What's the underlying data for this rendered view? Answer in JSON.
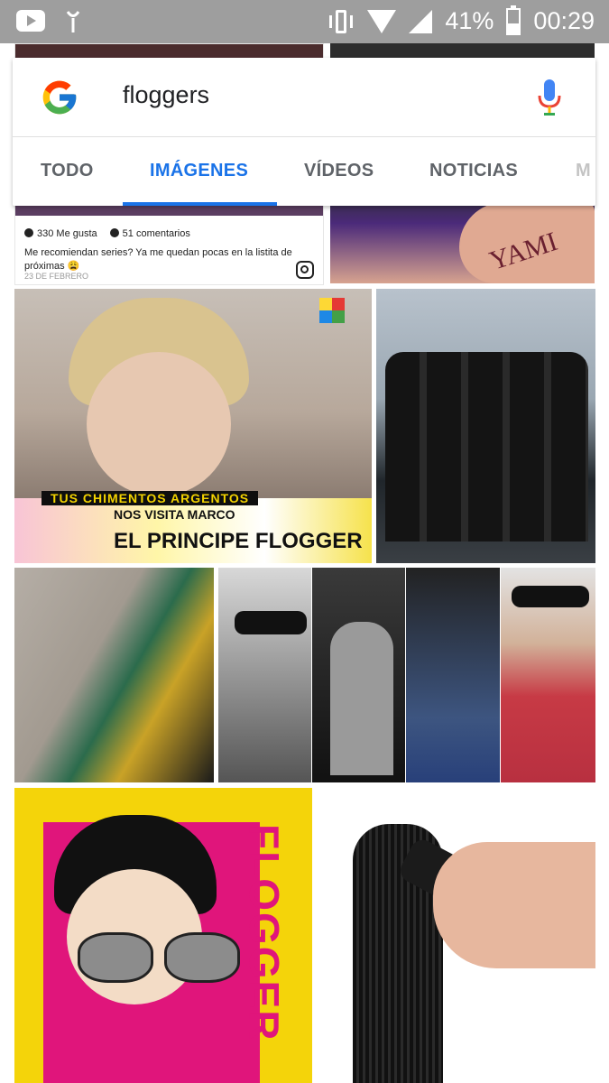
{
  "status_bar": {
    "icons": [
      "youtube-icon",
      "signal-antenna-icon",
      "vibrate-icon",
      "wifi-icon",
      "cell-signal-icon",
      "battery-icon"
    ],
    "battery": "41%",
    "time": "00:29"
  },
  "search": {
    "query": "floggers",
    "logo": "google-g-icon",
    "mic": "mic-icon"
  },
  "tabs": [
    {
      "label": "TODO",
      "active": false
    },
    {
      "label": "IMÁGENES",
      "active": true
    },
    {
      "label": "VÍDEOS",
      "active": false
    },
    {
      "label": "NOTICIAS",
      "active": false
    },
    {
      "label": "M",
      "active": false
    }
  ],
  "results": {
    "ig_card": {
      "likes": "330 Me gusta",
      "comments": "51 comentarios",
      "caption": "Me recomiendan series? Ya me quedan pocas en la listita de próximas 😩",
      "date": "23 DE FEBRERO",
      "icon": "instagram-icon"
    },
    "hand_text": "YAMI",
    "tv_overlay": {
      "top": "TUS CHIMENTOS ARGENTOS",
      "sub": "NOS VISITA MARCO",
      "main": "EL PRINCIPE FLOGGER"
    },
    "cartoon_text": "FLOGGER",
    "colors": {
      "accent": "#1a73e8",
      "tab_text": "#5f6368",
      "status_bar": "#9e9e9e"
    }
  }
}
